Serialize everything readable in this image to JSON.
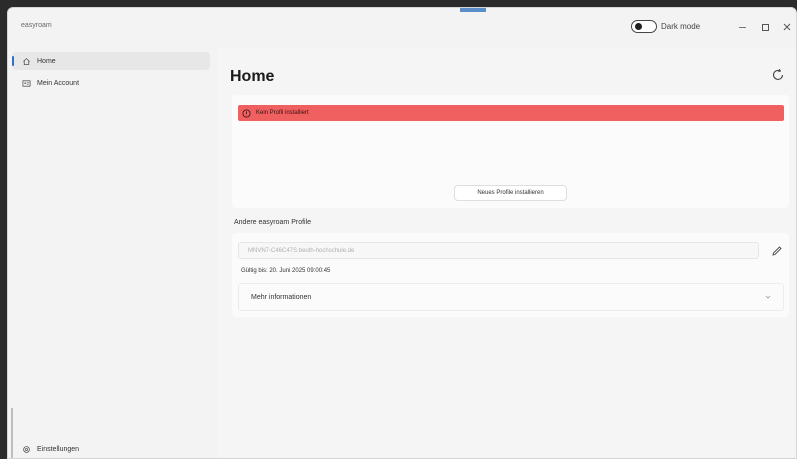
{
  "window": {
    "title": "easyroam",
    "dark_mode_label": "Dark mode",
    "dark_mode_on": false
  },
  "sidebar": {
    "items": [
      {
        "label": "Home",
        "icon": "home-icon",
        "active": true
      },
      {
        "label": "Mein Account",
        "icon": "account-card-icon",
        "active": false
      }
    ],
    "settings_label": "Einstellungen",
    "settings_icon": "gear-icon"
  },
  "main": {
    "title": "Home",
    "error_message": "Kein Profil installiert",
    "install_button_label": "Neues Profile installieren",
    "other_profiles_label": "Andere easyroam Profile",
    "profile_name": "MNVN7-C46C47S.beuth-hochschule.de",
    "valid_until": "Gültig bis: 20. Juni 2025 09:00:45",
    "more_info_label": "Mehr informationen"
  },
  "colors": {
    "accent": "#2f6fc8",
    "error": "#f06060"
  }
}
